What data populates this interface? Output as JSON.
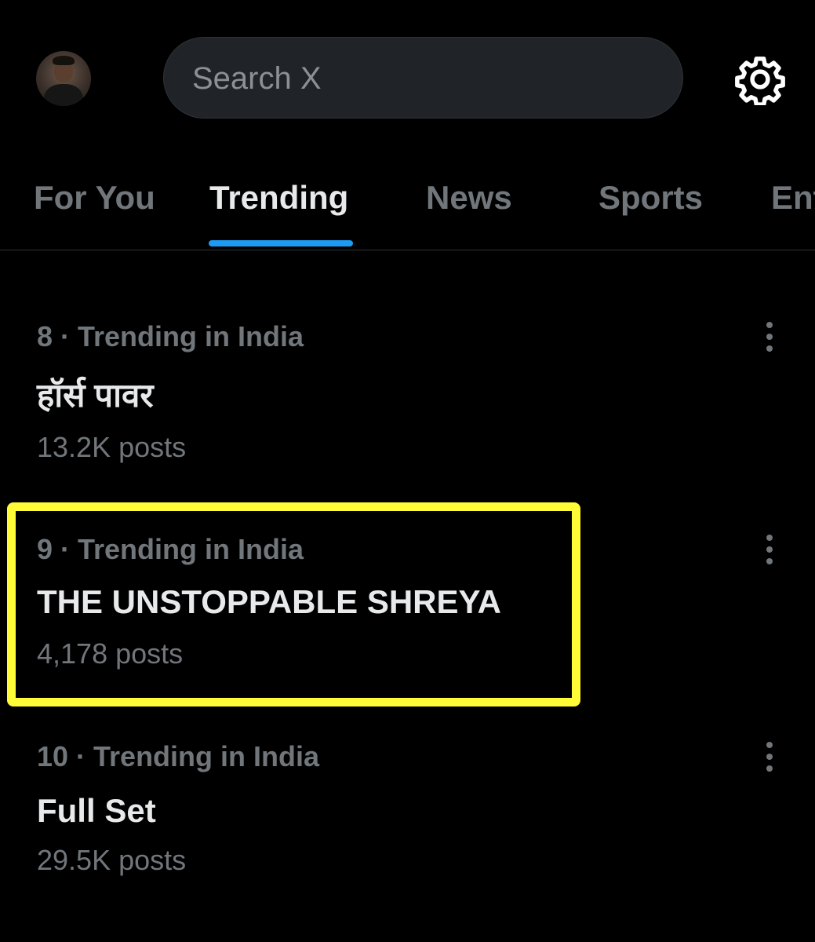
{
  "header": {
    "avatar_icon": "profile-avatar",
    "search_placeholder": "Search X",
    "settings_icon": "gear-icon"
  },
  "tabs": [
    {
      "label": "For You",
      "active": false
    },
    {
      "label": "Trending",
      "active": true
    },
    {
      "label": "News",
      "active": false
    },
    {
      "label": "Sports",
      "active": false
    },
    {
      "label": "Ent",
      "active": false
    }
  ],
  "trends": [
    {
      "meta": "8 · Trending in India",
      "name": "हॉर्स पावर",
      "posts": "13.2K posts"
    },
    {
      "meta": "9 · Trending in India",
      "name": "THE UNSTOPPABLE SHREYA",
      "posts": "4,178 posts",
      "highlighted": true
    },
    {
      "meta": "10 · Trending in India",
      "name": "Full Set",
      "posts": "29.5K posts"
    }
  ],
  "colors": {
    "background": "#000000",
    "accent": "#1d9bf0",
    "highlight": "#fffb36",
    "secondary_text": "#71767b",
    "primary_text": "#e7e9ea"
  }
}
